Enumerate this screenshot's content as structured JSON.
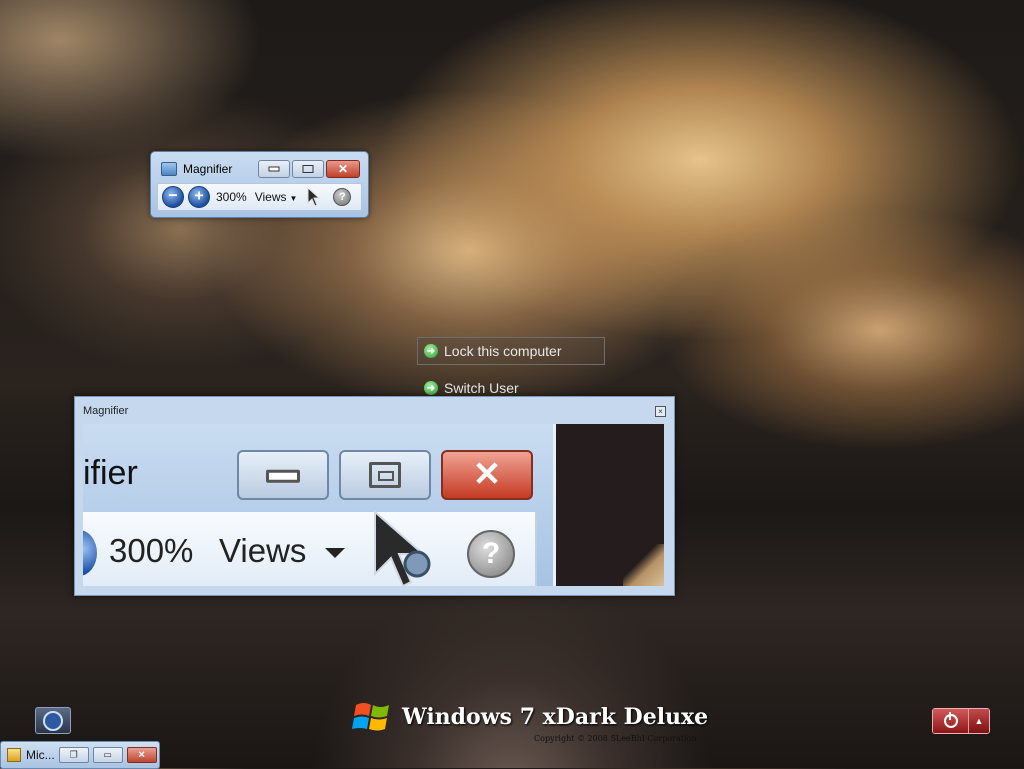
{
  "magnifier_toolbar": {
    "title": "Magnifier",
    "zoom": "300%",
    "views_label": "Views",
    "help_glyph": "?",
    "icons": [
      "magnifier-app-icon",
      "zoom-out-icon",
      "zoom-in-icon",
      "cursor-icon",
      "help-icon"
    ]
  },
  "logoff_menu": {
    "items": [
      {
        "label": "Lock this computer"
      },
      {
        "label": "Switch User"
      }
    ]
  },
  "magnifier_lens": {
    "title": "Magnifier",
    "mag_title_fragment": "ifier",
    "zoom": "300%",
    "views_label": "Views",
    "help_glyph": "?"
  },
  "branding": {
    "text": "Windows 7 xDark Deluxe",
    "copyright": "Copyright © 2008 SLeeBhI Corporation"
  },
  "taskbar_mini": {
    "label": "Mic..."
  },
  "colors": {
    "accent_blue": "#1d4e9e",
    "close_red": "#c0402b",
    "power_red": "#8e1515"
  }
}
